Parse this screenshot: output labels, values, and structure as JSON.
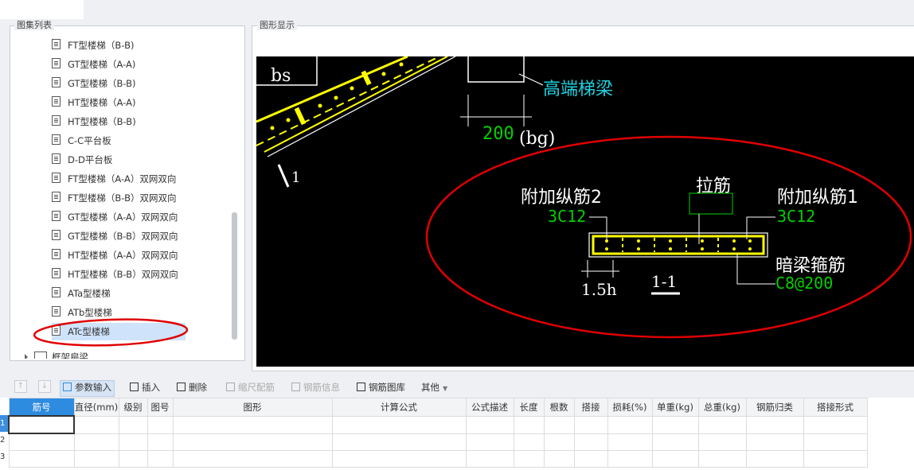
{
  "panels": {
    "tree_title": "图集列表",
    "graphic_title": "图形显示"
  },
  "tree": {
    "items": [
      {
        "label": "FT型楼梯（B-B)"
      },
      {
        "label": "GT型楼梯（A-A)"
      },
      {
        "label": "GT型楼梯（B-B)"
      },
      {
        "label": "HT型楼梯（A-A)"
      },
      {
        "label": "HT型楼梯（B-B)"
      },
      {
        "label": "C-C平台板"
      },
      {
        "label": "D-D平台板"
      },
      {
        "label": "FT型楼梯（A-A）双网双向"
      },
      {
        "label": "FT型楼梯（B-B）双网双向"
      },
      {
        "label": "GT型楼梯（A-A）双网双向"
      },
      {
        "label": "GT型楼梯（B-B）双网双向"
      },
      {
        "label": "HT型楼梯（A-A）双网双向"
      },
      {
        "label": "HT型楼梯（B-B）双网双向"
      },
      {
        "label": "ATa型楼梯"
      },
      {
        "label": "ATb型楼梯"
      },
      {
        "label": "ATc型楼梯"
      }
    ],
    "selected": "ATc型楼梯",
    "folder": "框架扁梁"
  },
  "drawing": {
    "bs": "bs",
    "high_beam": "高端梯梁",
    "dim_200": "200",
    "bg": "(bg)",
    "one": "1",
    "extra_long2": "附加纵筋2",
    "c12_left": "3C12",
    "tie": "拉筋",
    "extra_long1": "附加纵筋1",
    "c12_right": "3C12",
    "hidden_beam_stirrup": "暗梁箍筋",
    "c8": "C8@200",
    "h15": "1.5h",
    "section": "1-1"
  },
  "toolbar": {
    "param_input": "参数输入",
    "insert": "插入",
    "delete": "删除",
    "scale_rebar": "缩尺配筋",
    "rebar_info": "钢筋信息",
    "rebar_library": "钢筋图库",
    "other": "其他"
  },
  "table": {
    "headers": [
      "筋号",
      "直径(mm)",
      "级别",
      "图号",
      "图形",
      "计算公式",
      "公式描述",
      "长度",
      "根数",
      "搭接",
      "损耗(%)",
      "单重(kg)",
      "总重(kg)",
      "钢筋归类",
      "搭接形式"
    ],
    "row_numbers": [
      "1",
      "2",
      "3"
    ]
  },
  "colors": {
    "accent": "#2d8be0",
    "annotation": "#e00000",
    "rebar": "#ffff00",
    "label_green": "#00d000",
    "label_cyan": "#20d0e0"
  }
}
